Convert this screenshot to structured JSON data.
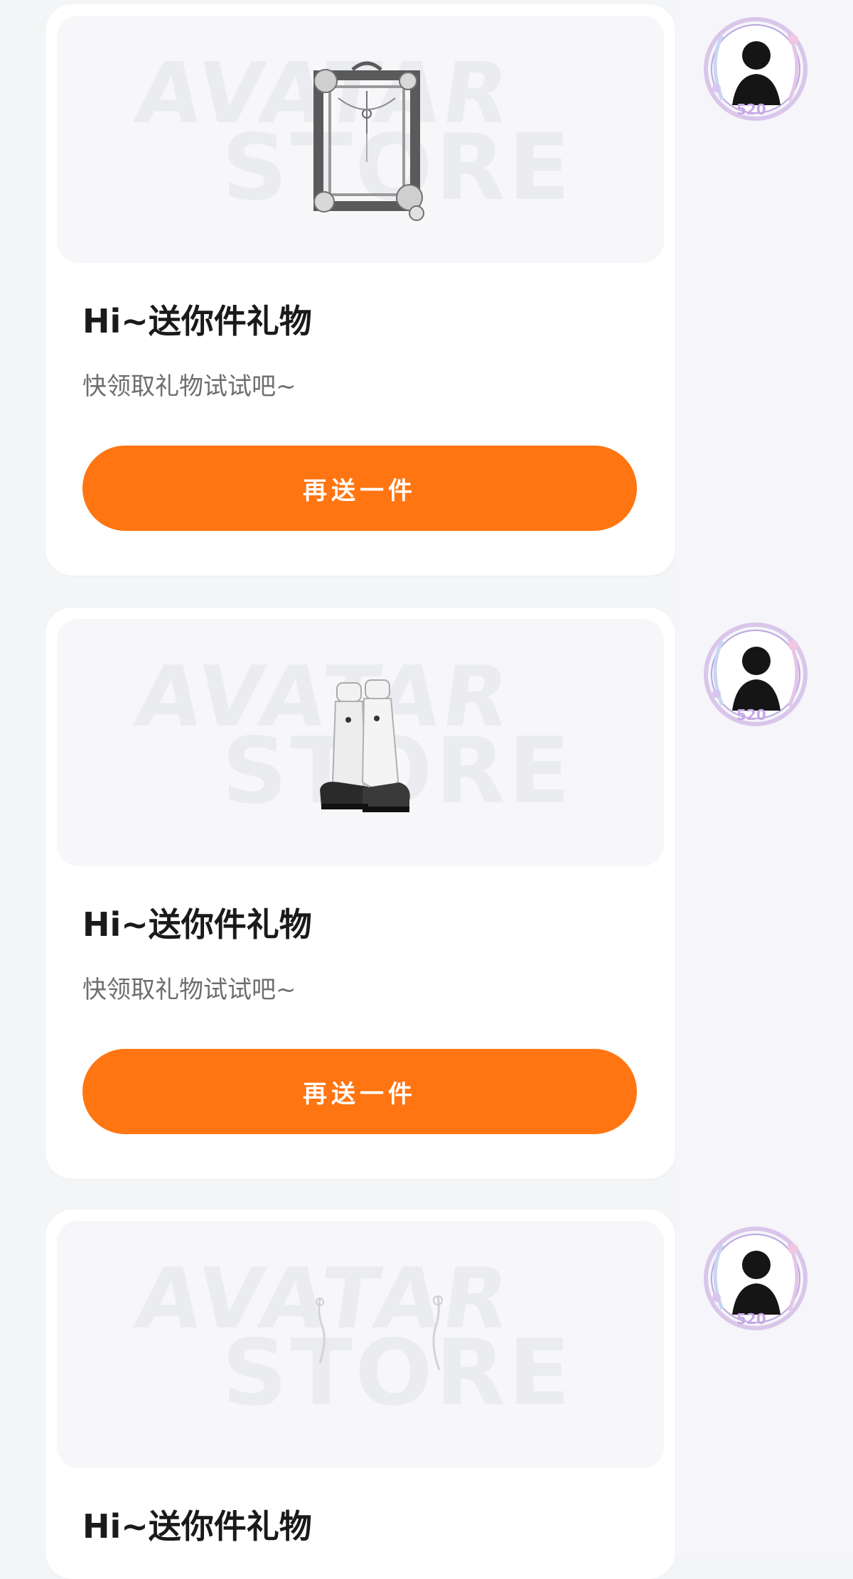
{
  "colors": {
    "accent": "#ff7512",
    "card_bg": "#ffffff",
    "page_bg": "#f3f5f6"
  },
  "watermark": {
    "line1": "AVATAR",
    "line2": "STORE"
  },
  "messages": [
    {
      "title": "Hi~送你件礼物",
      "subtitle": "快领取礼物试试吧~",
      "button_label": "再送一件",
      "gift_icon": "ornate-mirror-frame-icon",
      "avatar_badge": "520"
    },
    {
      "title": "Hi~送你件礼物",
      "subtitle": "快领取礼物试试吧~",
      "button_label": "再送一件",
      "gift_icon": "white-boots-icon",
      "avatar_badge": "520"
    },
    {
      "title": "Hi~送你件礼物",
      "gift_icon": "earrings-icon",
      "avatar_badge": "520"
    }
  ]
}
